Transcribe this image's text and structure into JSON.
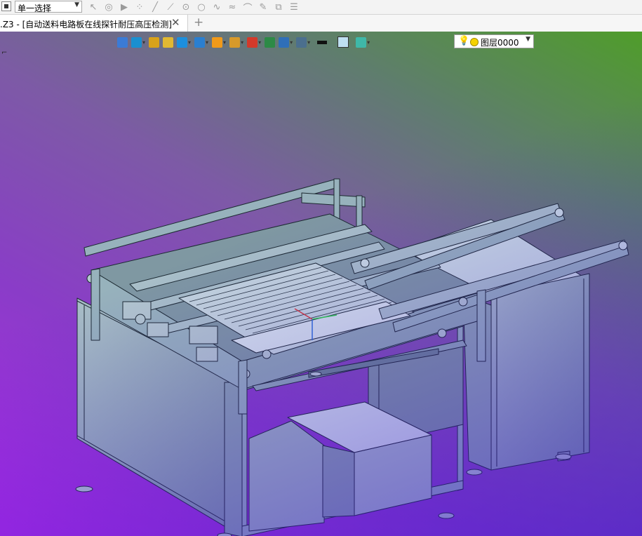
{
  "toolbar": {
    "selection_mode": "单一选择",
    "tools": [
      {
        "icon": "pointer-icon",
        "glyph": "↖"
      },
      {
        "icon": "lasso-icon",
        "glyph": "◎"
      },
      {
        "icon": "play-icon",
        "glyph": "▶"
      },
      {
        "icon": "point-icon",
        "glyph": "⁘"
      },
      {
        "icon": "line-icon",
        "glyph": "╱"
      },
      {
        "icon": "polyline-icon",
        "glyph": "⟋"
      },
      {
        "icon": "circle-center-icon",
        "glyph": "⊙"
      },
      {
        "icon": "circle-icon",
        "glyph": "○"
      },
      {
        "icon": "spline-icon",
        "glyph": "∿"
      },
      {
        "icon": "curve-icon",
        "glyph": "≈"
      },
      {
        "icon": "arc-icon",
        "glyph": "⌒"
      },
      {
        "icon": "pen-icon",
        "glyph": "✎"
      },
      {
        "icon": "layers-icon",
        "glyph": "⧉"
      },
      {
        "icon": "stack-icon",
        "glyph": "☰"
      }
    ]
  },
  "tabs": [
    {
      "title": ".Z3 - [自动送料电路板在线探针耐压高压检测]"
    }
  ],
  "view_toolbar": {
    "buttons": [
      {
        "name": "open-view-icon",
        "color": "#3b7bd6",
        "dropdown": false
      },
      {
        "name": "pick-filter-icon",
        "color": "#1a8fd0",
        "dropdown": true
      },
      {
        "name": "sketch-icon",
        "color": "#d8a21a",
        "dropdown": false
      },
      {
        "name": "shade-icon",
        "color": "#e1b832",
        "dropdown": false
      },
      {
        "name": "cube-view-icon",
        "color": "#1c8fde",
        "dropdown": true
      },
      {
        "name": "display-mode-icon",
        "color": "#2a7fd0",
        "dropdown": true
      },
      {
        "name": "render-icon",
        "color": "#f09a1a",
        "dropdown": true
      },
      {
        "name": "zoom-icon",
        "color": "#d79a2a",
        "dropdown": true
      },
      {
        "name": "orient-icon",
        "color": "#d33a2a",
        "dropdown": true
      },
      {
        "name": "grid-icon",
        "color": "#2d8a46",
        "dropdown": false
      },
      {
        "name": "measure-icon",
        "color": "#2f6fb8",
        "dropdown": true
      },
      {
        "name": "screen-icon",
        "color": "#4b6f8e",
        "dropdown": true
      }
    ],
    "plane_dropdown_icon": "plane-icon",
    "layer_label": "图层0000"
  },
  "colors": {
    "frame": "#97b2bc",
    "frame_dark": "#667f89",
    "panel": "#9bb3bd",
    "box": "#c5d8df",
    "edge": "#1c2a31"
  }
}
